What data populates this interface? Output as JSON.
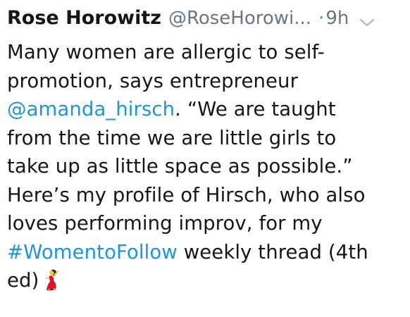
{
  "tweet": {
    "author_name": "Rose Horowitz",
    "author_handle": "@RoseHorowi...",
    "separator": "·",
    "timestamp": "9h",
    "menu_icon": "chevron-down-icon",
    "lines": [
      {
        "parts": [
          {
            "text": "Many women are allergic to self-"
          }
        ]
      },
      {
        "parts": [
          {
            "text": "promotion, says entrepreneur"
          }
        ]
      },
      {
        "parts": [
          {
            "text": "@amanda_hirsch",
            "type": "mention"
          },
          {
            "text": ". “We are taught"
          }
        ]
      },
      {
        "parts": [
          {
            "text": "from the time we are little girls to"
          }
        ]
      },
      {
        "parts": [
          {
            "text": "take up as little space as possible.”"
          }
        ]
      },
      {
        "parts": [
          {
            "text": "Here’s my profile of Hirsch, who also"
          }
        ]
      },
      {
        "parts": [
          {
            "text": "loves performing improv, for my"
          }
        ]
      },
      {
        "parts": [
          {
            "text": "#WomentoFollow",
            "type": "hashtag"
          },
          {
            "text": " weekly thread (4th"
          }
        ]
      },
      {
        "parts": [
          {
            "text": "ed)"
          }
        ]
      }
    ],
    "emoji": "dancer-emoji",
    "colors": {
      "text": "#14171a",
      "secondary": "#657786",
      "link": "#1b95e0"
    }
  }
}
